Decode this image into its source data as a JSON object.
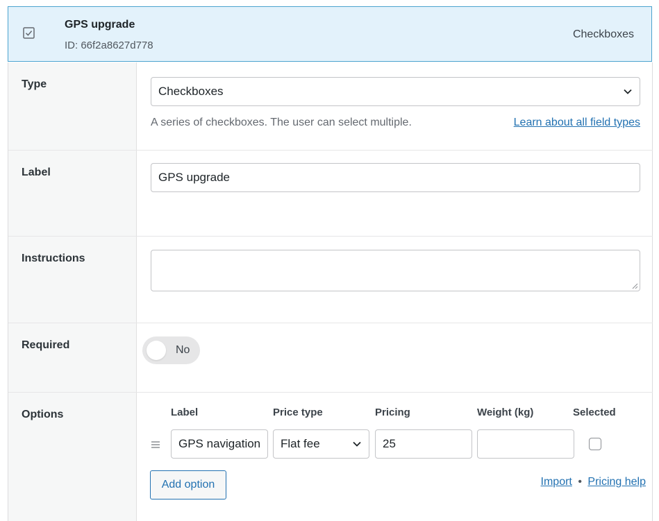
{
  "field": {
    "title": "GPS upgrade",
    "id_text": "ID: 66f2a8627d778",
    "type_label": "Checkboxes",
    "icon": "checkbox-icon"
  },
  "type_setting": {
    "label": "Type",
    "selected": "Checkboxes",
    "description": "A series of checkboxes. The user can select multiple.",
    "learn_link": "Learn about all field types"
  },
  "label_setting": {
    "label": "Label",
    "value": "GPS upgrade"
  },
  "instructions_setting": {
    "label": "Instructions",
    "value": ""
  },
  "required_setting": {
    "label": "Required",
    "toggle_text": "No",
    "on": false
  },
  "options_setting": {
    "label": "Options",
    "columns": [
      "Label",
      "Price type",
      "Pricing",
      "Weight (kg)",
      "Selected"
    ],
    "rows": [
      {
        "label": "GPS navigation",
        "price_type": "Flat fee",
        "pricing": "25",
        "weight": "",
        "selected": false
      }
    ],
    "add_button": "Add option",
    "import_link": "Import",
    "separator": "•",
    "pricing_help_link": "Pricing help"
  },
  "colors": {
    "header_bg": "#e3f2fb",
    "header_border": "#4ba3cf",
    "link": "#2271b1",
    "label_column_bg": "#f6f7f7"
  }
}
